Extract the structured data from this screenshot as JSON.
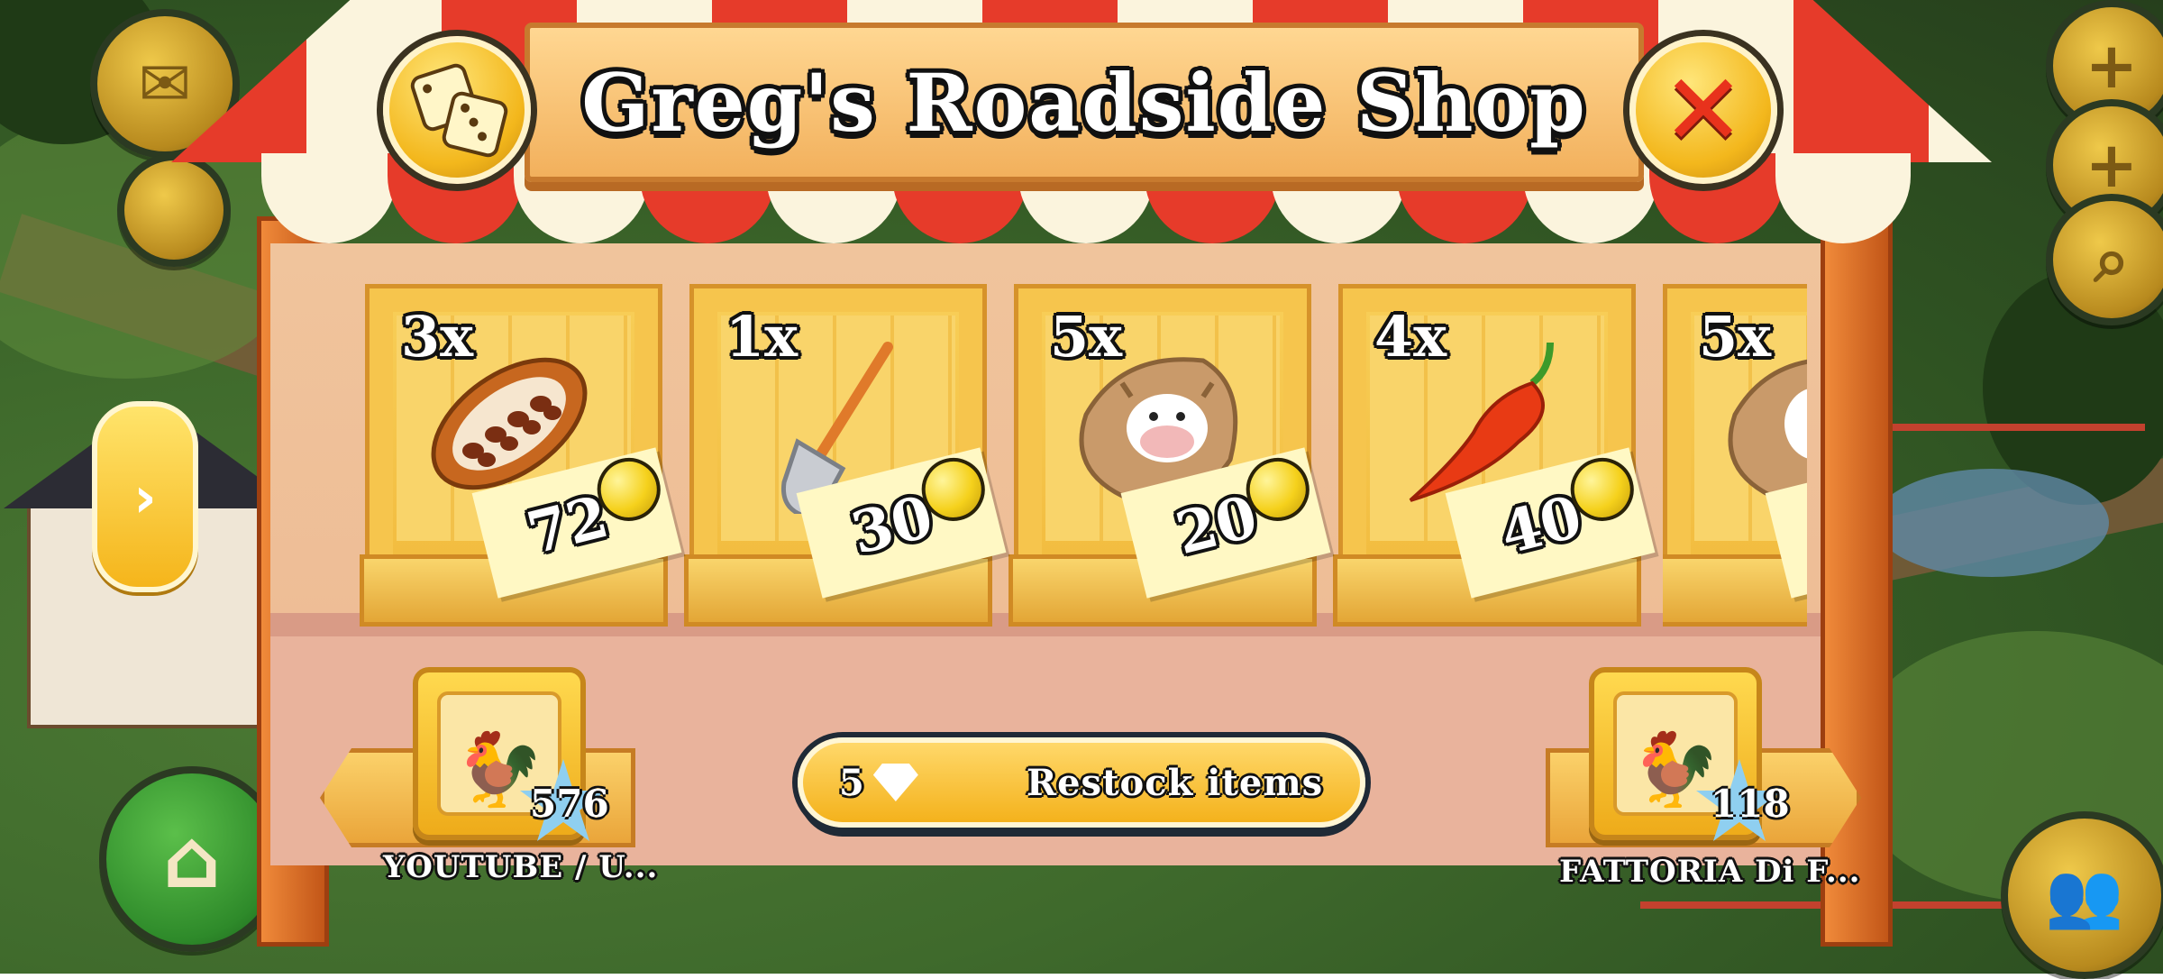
{
  "shop": {
    "title": "Greg's Roadside Shop",
    "dice_icon": "dice-icon",
    "close_icon": "close-icon"
  },
  "items": [
    {
      "qty": "3x",
      "price": "72",
      "icon": "cacao-pod-icon"
    },
    {
      "qty": "1x",
      "price": "30",
      "icon": "shovel-icon"
    },
    {
      "qty": "5x",
      "price": "20",
      "icon": "cow-feed-sack-icon"
    },
    {
      "qty": "4x",
      "price": "40",
      "icon": "chili-pepper-icon"
    },
    {
      "qty": "5x",
      "price": "",
      "icon": "chicken-feed-sack-icon"
    }
  ],
  "restock": {
    "cost": "5",
    "label": "Restock items",
    "icon": "diamond-icon"
  },
  "neighbors": {
    "left": {
      "level": "576",
      "name": "YOUTUBE / U...",
      "icon": "rooster-icon"
    },
    "right": {
      "level": "118",
      "name": "FATTORIA Di F...",
      "icon": "rooster-icon"
    }
  },
  "hud": {
    "left_icons": [
      "mail-icon",
      "home-icon",
      "arrow-right-icon"
    ],
    "right_icons": [
      "plus-icon",
      "plus-icon",
      "magnifier-icon",
      "friends-icon"
    ]
  },
  "colors": {
    "awning_red": "#e63b2a",
    "awning_cream": "#fbf4dd",
    "crate_yellow": "#f6c54d",
    "coin_gold": "#f5d11c"
  }
}
